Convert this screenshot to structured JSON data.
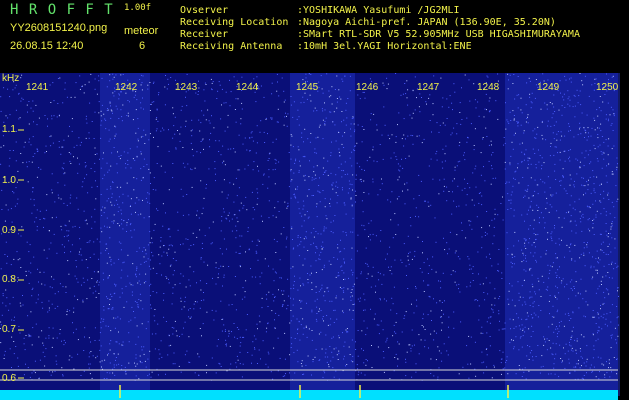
{
  "app": {
    "name": "H R O F F T",
    "version": "1.00f",
    "filename": "YY2608151240.png",
    "datetime": "26.08.15 12:40",
    "counter_label": "meteor",
    "counter_value": "6"
  },
  "info": [
    {
      "label": "Ovserver",
      "value": ":YOSHIKAWA Yasufumi /JG2MLI"
    },
    {
      "label": "Receiving Location",
      "value": ":Nagoya Aichi-pref. JAPAN (136.90E, 35.20N)"
    },
    {
      "label": "Receiver",
      "value": ":SMart RTL-SDR V5 52.905MHz USB HIGASHIMURAYAMA"
    },
    {
      "label": "Receiving Antenna",
      "value": ":10mH 3el.YAGI Horizontal:ENE"
    }
  ],
  "axis": {
    "unit": "kHz",
    "ticks": [
      "1.1",
      "1.0",
      "0.9",
      "0.8",
      "0.7",
      "0.6"
    ],
    "minutes": [
      "1241",
      "1242",
      "1243",
      "1244",
      "1245",
      "1246",
      "1247",
      "1248",
      "1249",
      "1250"
    ]
  },
  "colors": {
    "label": "#f2f24a",
    "title": "#63e36b",
    "background": "#000000",
    "noise_base": "#0a0f78",
    "signal": "#00e0ff"
  }
}
